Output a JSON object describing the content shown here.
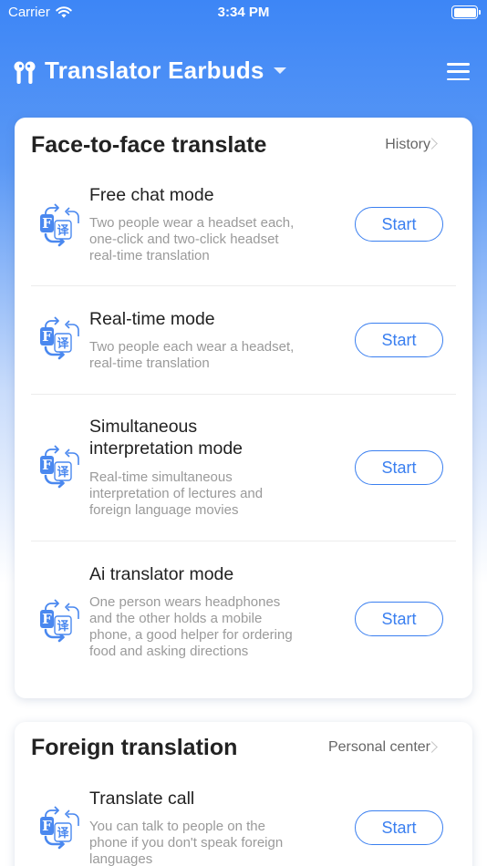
{
  "status_bar": {
    "carrier": "Carrier",
    "time": "3:34 PM"
  },
  "nav": {
    "title": "Translator Earbuds"
  },
  "face_to_face": {
    "title": "Face-to-face translate",
    "link": "History",
    "modes": [
      {
        "name": "Free chat mode",
        "desc": "Two people wear a headset each, one-click and two-click headset real-time translation",
        "button": "Start"
      },
      {
        "name": "Real-time mode",
        "desc": "Two people each wear a headset, real-time translation",
        "button": "Start"
      },
      {
        "name": "Simultaneous interpretation mode",
        "desc": "Real-time simultaneous interpretation of lectures and foreign language movies",
        "button": "Start"
      },
      {
        "name": "Ai translator mode",
        "desc": "One person wears headphones and the other holds a mobile phone, a good helper for ordering food and asking directions",
        "button": "Start"
      }
    ]
  },
  "foreign": {
    "title": "Foreign translation",
    "link": "Personal center",
    "modes": [
      {
        "name": "Translate call",
        "desc": "You can talk to people on the phone if you don't speak foreign languages",
        "button": "Start"
      }
    ]
  },
  "icon_glyphs": {
    "letter": "F",
    "char": "译"
  },
  "colors": {
    "accent": "#3a7ff0",
    "header_blue": "#3d86f6"
  }
}
